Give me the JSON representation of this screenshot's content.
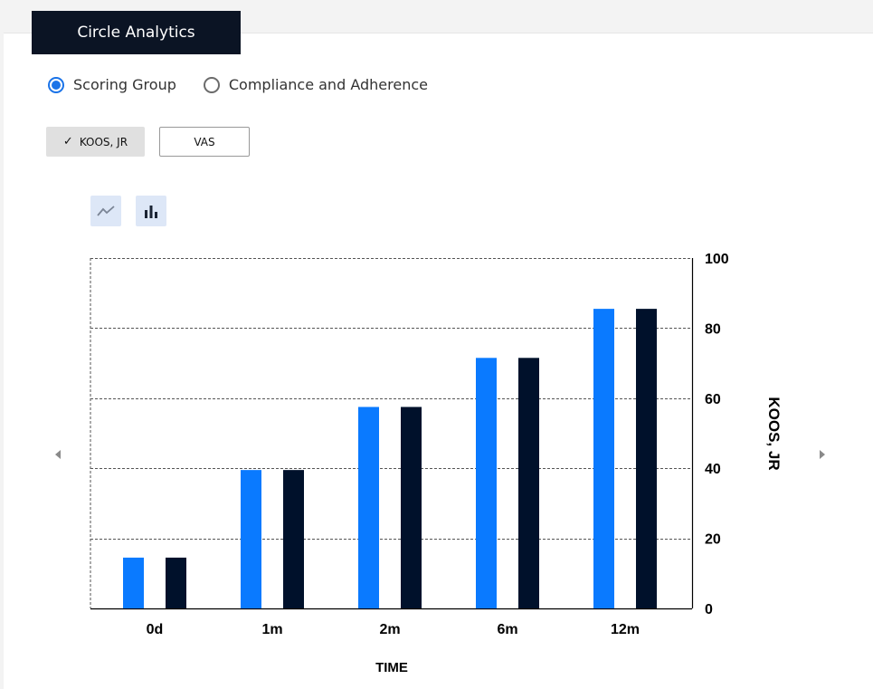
{
  "tab": {
    "label": "Circle Analytics"
  },
  "view_options": [
    {
      "label": "Scoring Group",
      "selected": true
    },
    {
      "label": "Compliance and Adherence",
      "selected": false
    }
  ],
  "measures": [
    {
      "label": "KOOS, JR",
      "selected": true
    },
    {
      "label": "VAS",
      "selected": false
    }
  ],
  "chart_toggle": {
    "line_icon": "line-chart-icon",
    "bar_icon": "bar-chart-icon",
    "active": "bar"
  },
  "colors": {
    "series_a": "#0a7aff",
    "series_b": "#00112b",
    "radio_accent": "#1a73e8",
    "tab_bg": "#0b1424"
  },
  "chart_data": {
    "type": "bar",
    "categories": [
      "0d",
      "1m",
      "2m",
      "6m",
      "12m"
    ],
    "series": [
      {
        "values": [
          14.5,
          39.5,
          57.5,
          71.5,
          85.5
        ]
      },
      {
        "values": [
          14.5,
          39.5,
          57.5,
          71.5,
          85.5
        ]
      }
    ],
    "xlabel": "TIME",
    "ylabel": "KOOS, JR",
    "ylim": [
      0,
      100
    ],
    "yticks": [
      "0",
      "20",
      "40",
      "60",
      "80",
      "100"
    ],
    "grid": true,
    "y_axis_side": "right"
  }
}
